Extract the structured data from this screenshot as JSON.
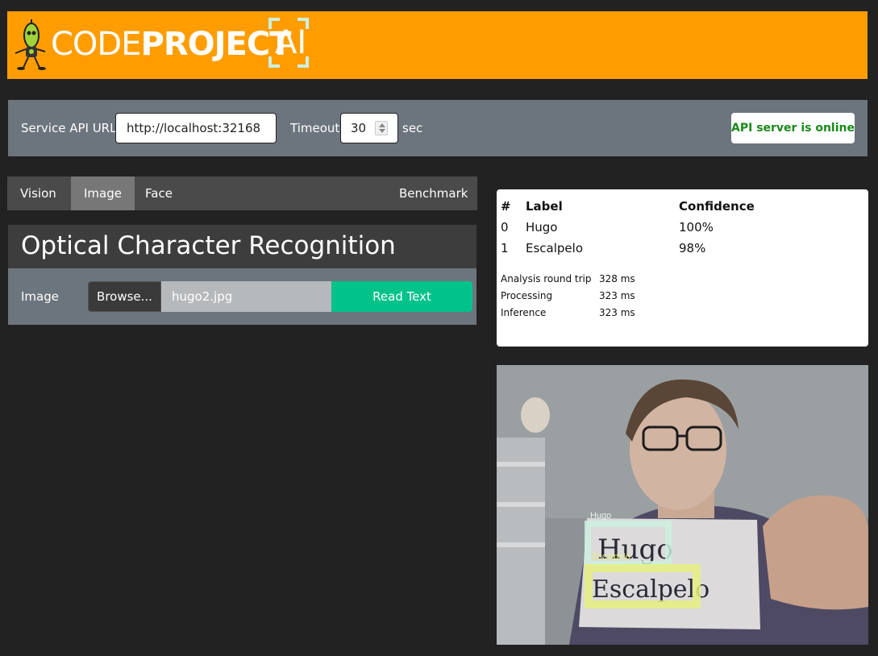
{
  "header": {
    "logo_code": "CODE",
    "logo_project": "PROJECT",
    "logo_ai": "AI"
  },
  "api": {
    "service_label": "Service API URL",
    "service_url": "http://localhost:32168",
    "timeout_label": "Timeout",
    "timeout_value": "30",
    "timeout_unit": "sec",
    "status": "API server is online"
  },
  "tabs": [
    {
      "label": "Vision",
      "active": false
    },
    {
      "label": "Image",
      "active": true
    },
    {
      "label": "Face",
      "active": false
    },
    {
      "label": "Benchmark",
      "active": false
    }
  ],
  "ocr": {
    "title": "Optical Character Recognition",
    "image_label": "Image",
    "browse_label": "Browse...",
    "file_name": "hugo2.jpg",
    "read_button": "Read Text"
  },
  "results": {
    "headers": [
      "#",
      "Label",
      "Confidence"
    ],
    "rows": [
      {
        "idx": "0",
        "label": "Hugo",
        "confidence": "100%"
      },
      {
        "idx": "1",
        "label": "Escalpelo",
        "confidence": "98%"
      }
    ],
    "timings": [
      {
        "label": "Analysis round trip",
        "value": "328 ms"
      },
      {
        "label": "Processing",
        "value": "323 ms"
      },
      {
        "label": "Inference",
        "value": "323 ms"
      }
    ]
  },
  "photo": {
    "detection_labels": [
      "Hugo",
      "Escalpelo"
    ],
    "paper_words": [
      "Hugo",
      "Escalpelo"
    ]
  },
  "colors": {
    "brand_orange": "#ff9d00",
    "status_green": "#198a19",
    "read_button": "#00c28a",
    "box_hugo": "#cdf0de",
    "box_escalpelo": "#e6ef80"
  }
}
